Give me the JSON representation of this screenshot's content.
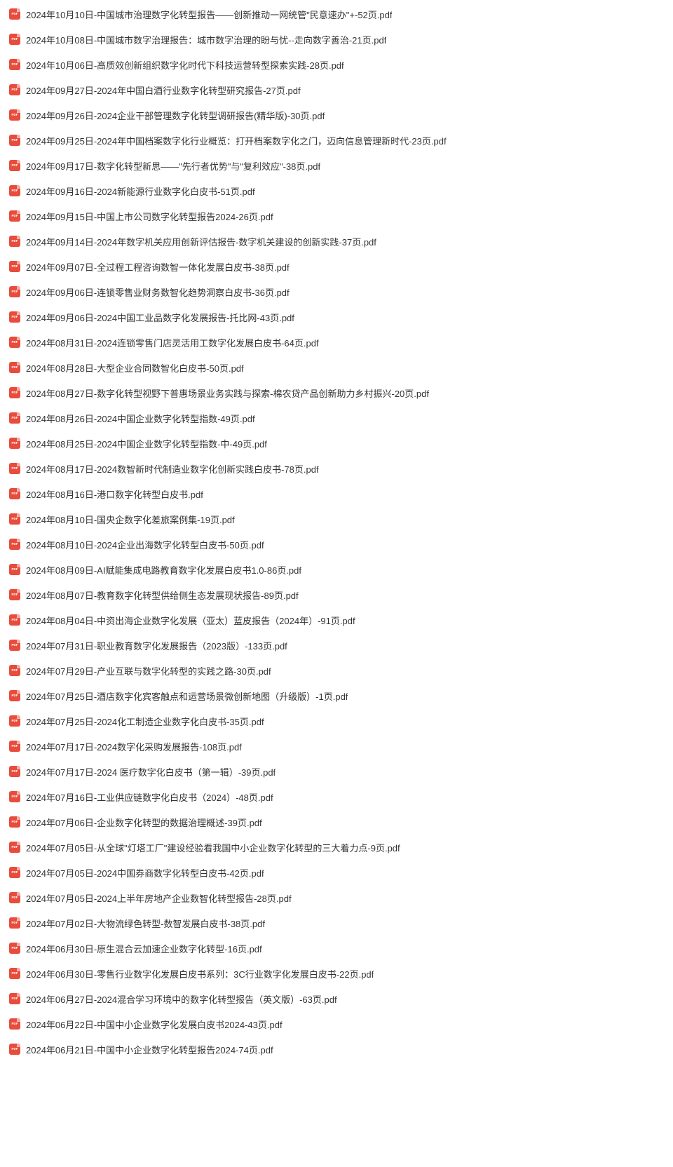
{
  "icon_label": "PDF",
  "icon_name": "pdf-icon",
  "icon_bg": "#e84c3d",
  "files": [
    {
      "name": "2024年10月10日-中国城市治理数字化转型报告——创新推动一网统管\"民意速办\"+-52页.pdf"
    },
    {
      "name": "2024年10月08日-中国城市数字治理报告：城市数字治理的盼与忧--走向数字善治-21页.pdf"
    },
    {
      "name": "2024年10月06日-高质效创新组织数字化时代下科技运营转型探索实践-28页.pdf"
    },
    {
      "name": "2024年09月27日-2024年中国白酒行业数字化转型研究报告-27页.pdf"
    },
    {
      "name": "2024年09月26日-2024企业干部管理数字化转型调研报告(精华版)-30页.pdf"
    },
    {
      "name": "2024年09月25日-2024年中国档案数字化行业概览：打开档案数字化之门，迈向信息管理新时代-23页.pdf"
    },
    {
      "name": "2024年09月17日-数字化转型新思——\"先行者优势\"与\"复利效应\"-38页.pdf"
    },
    {
      "name": "2024年09月16日-2024新能源行业数字化白皮书-51页.pdf"
    },
    {
      "name": "2024年09月15日-中国上市公司数字化转型报告2024-26页.pdf"
    },
    {
      "name": "2024年09月14日-2024年数字机关应用创新评估报告-数字机关建设的创新实践-37页.pdf"
    },
    {
      "name": "2024年09月07日-全过程工程咨询数智一体化发展白皮书-38页.pdf"
    },
    {
      "name": "2024年09月06日-连锁零售业财务数智化趋势洞察白皮书-36页.pdf"
    },
    {
      "name": "2024年09月06日-2024中国工业品数字化发展报告-托比网-43页.pdf"
    },
    {
      "name": "2024年08月31日-2024连锁零售门店灵活用工数字化发展白皮书-64页.pdf"
    },
    {
      "name": "2024年08月28日-大型企业合同数智化白皮书-50页.pdf"
    },
    {
      "name": "2024年08月27日-数字化转型视野下普惠场景业务实践与探索-棉农贷产品创新助力乡村振兴-20页.pdf"
    },
    {
      "name": "2024年08月26日-2024中国企业数字化转型指数-49页.pdf"
    },
    {
      "name": "2024年08月25日-2024中国企业数字化转型指数-中-49页.pdf"
    },
    {
      "name": "2024年08月17日-2024数智新时代制造业数字化创新实践白皮书-78页.pdf"
    },
    {
      "name": "2024年08月16日-港口数字化转型白皮书.pdf"
    },
    {
      "name": "2024年08月10日-国央企数字化差旅案例集-19页.pdf"
    },
    {
      "name": "2024年08月10日-2024企业出海数字化转型白皮书-50页.pdf"
    },
    {
      "name": "2024年08月09日-AI赋能集成电路教育数字化发展白皮书1.0-86页.pdf"
    },
    {
      "name": "2024年08月07日-教育数字化转型供给侧生态发展现状报告-89页.pdf"
    },
    {
      "name": "2024年08月04日-中资出海企业数字化发展（亚太）蓝皮报告（2024年）-91页.pdf"
    },
    {
      "name": "2024年07月31日-职业教育数字化发展报告（2023版）-133页.pdf"
    },
    {
      "name": "2024年07月29日-产业互联与数字化转型的实践之路-30页.pdf"
    },
    {
      "name": "2024年07月25日-酒店数字化宾客触点和运营场景微创新地图（升级版）-1页.pdf"
    },
    {
      "name": "2024年07月25日-2024化工制造企业数字化白皮书-35页.pdf"
    },
    {
      "name": "2024年07月17日-2024数字化采购发展报告-108页.pdf"
    },
    {
      "name": "2024年07月17日-2024 医疗数字化白皮书（第一辑）-39页.pdf"
    },
    {
      "name": "2024年07月16日-工业供应链数字化白皮书（2024）-48页.pdf"
    },
    {
      "name": "2024年07月06日-企业数字化转型的数据治理概述-39页.pdf"
    },
    {
      "name": "2024年07月05日-从全球\"灯塔工厂\"建设经验看我国中小企业数字化转型的三大着力点-9页.pdf"
    },
    {
      "name": "2024年07月05日-2024中国券商数字化转型白皮书-42页.pdf"
    },
    {
      "name": "2024年07月05日-2024上半年房地产企业数智化转型报告-28页.pdf"
    },
    {
      "name": "2024年07月02日-大物流绿色转型-数智发展白皮书-38页.pdf"
    },
    {
      "name": "2024年06月30日-原生混合云加速企业数字化转型-16页.pdf"
    },
    {
      "name": "2024年06月30日-零售行业数字化发展白皮书系列：3C行业数字化发展白皮书-22页.pdf"
    },
    {
      "name": "2024年06月27日-2024混合学习环境中的数字化转型报告（英文版）-63页.pdf"
    },
    {
      "name": "2024年06月22日-中国中小企业数字化发展白皮书2024-43页.pdf"
    },
    {
      "name": "2024年06月21日-中国中小企业数字化转型报告2024-74页.pdf"
    }
  ]
}
